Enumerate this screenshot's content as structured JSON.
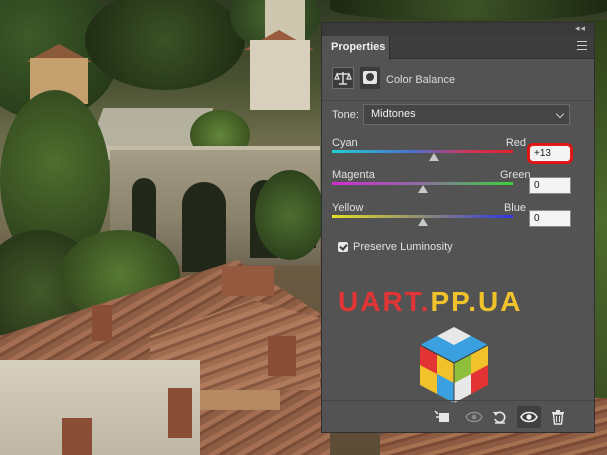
{
  "panel": {
    "collapse_glyph": "◂◂",
    "tab_label": "Properties",
    "menu_icon": "hamburger-menu-icon",
    "adjustment_icon": "balance-scale-icon",
    "mask_icon": "layer-mask-icon",
    "adjustment_title": "Color Balance"
  },
  "tone": {
    "label": "Tone:",
    "selected": "Midtones"
  },
  "sliders": [
    {
      "left_label": "Cyan",
      "right_label": "Red",
      "value": "+13",
      "numeric": 13,
      "highlighted": true
    },
    {
      "left_label": "Magenta",
      "right_label": "Green",
      "value": "0",
      "numeric": 0,
      "highlighted": false
    },
    {
      "left_label": "Yellow",
      "right_label": "Blue",
      "value": "0",
      "numeric": 0,
      "highlighted": false
    }
  ],
  "slider_range": [
    -100,
    100
  ],
  "preserve": {
    "label": "Preserve Luminosity",
    "checked": true
  },
  "watermark": {
    "part1": "UART.",
    "part2": "PP.UA"
  },
  "bottom_bar": {
    "icons": [
      "clip-to-layer-icon",
      "view-previous-state-icon",
      "reset-icon",
      "visibility-eye-icon",
      "trash-icon"
    ]
  },
  "colors": {
    "panel_bg": "#535353",
    "highlight_ring": "#e11313",
    "watermark_red": "#e23434",
    "watermark_yellow": "#f2c22b"
  }
}
